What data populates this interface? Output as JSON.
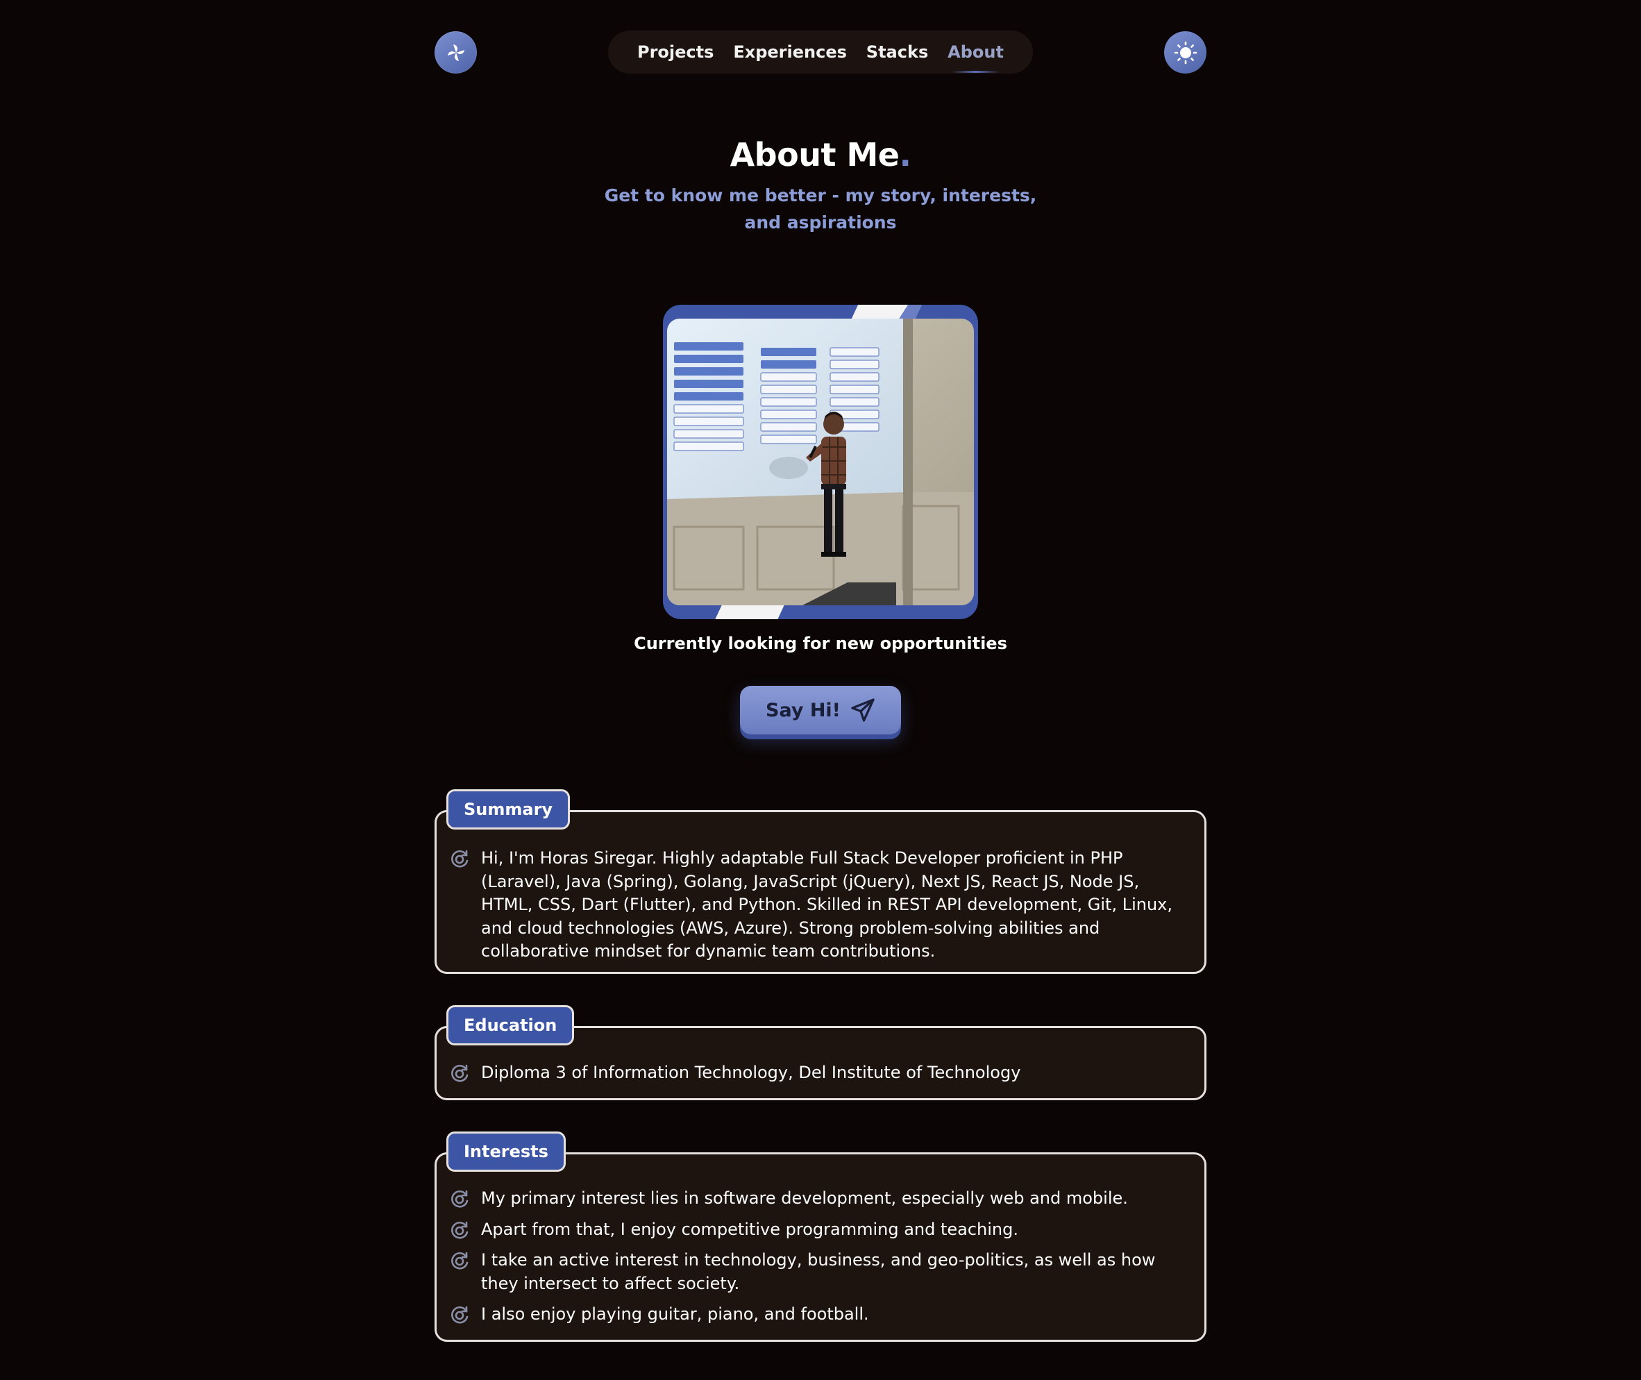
{
  "nav": {
    "logo_icon": "pinwheel-logo-icon",
    "links": [
      "Projects",
      "Experiences",
      "Stacks",
      "About"
    ],
    "active": "About",
    "theme_icon": "sun-icon"
  },
  "header": {
    "title": "About Me",
    "title_dot": ".",
    "subtitle": "Get to know me better - my story, interests, and aspirations"
  },
  "profile": {
    "photo_icon": "profile-photo",
    "status": "Currently looking for new opportunities",
    "cta_label": "Say Hi!",
    "cta_icon": "send-icon"
  },
  "sections": {
    "summary": {
      "label": "Summary",
      "items": [
        "Hi, I'm Horas Siregar. Highly adaptable Full Stack Developer proficient in PHP (Laravel), Java (Spring), Golang, JavaScript (jQuery), Next JS, React JS, Node JS, HTML, CSS, Dart (Flutter), and Python. Skilled in REST API development, Git, Linux, and cloud technologies (AWS, Azure). Strong problem-solving abilities and collaborative mindset for dynamic team contributions."
      ]
    },
    "education": {
      "label": "Education",
      "items": [
        "Diploma 3 of Information Technology, Del Institute of Technology"
      ]
    },
    "interests": {
      "label": "Interests",
      "items": [
        "My primary interest lies in software development, especially web and mobile.",
        "Apart from that, I enjoy competitive programming and teaching.",
        "I take an active interest in technology, business, and geo-politics, as well as how they intersect to affect society.",
        "I also enjoy playing guitar, piano, and football."
      ]
    },
    "bullet_icon": "orbit-bullet-icon"
  },
  "colors": {
    "background": "#0b0605",
    "accent": "#3d55a5",
    "accent_light": "#8d9dd8",
    "card_bg": "#1d130f"
  }
}
